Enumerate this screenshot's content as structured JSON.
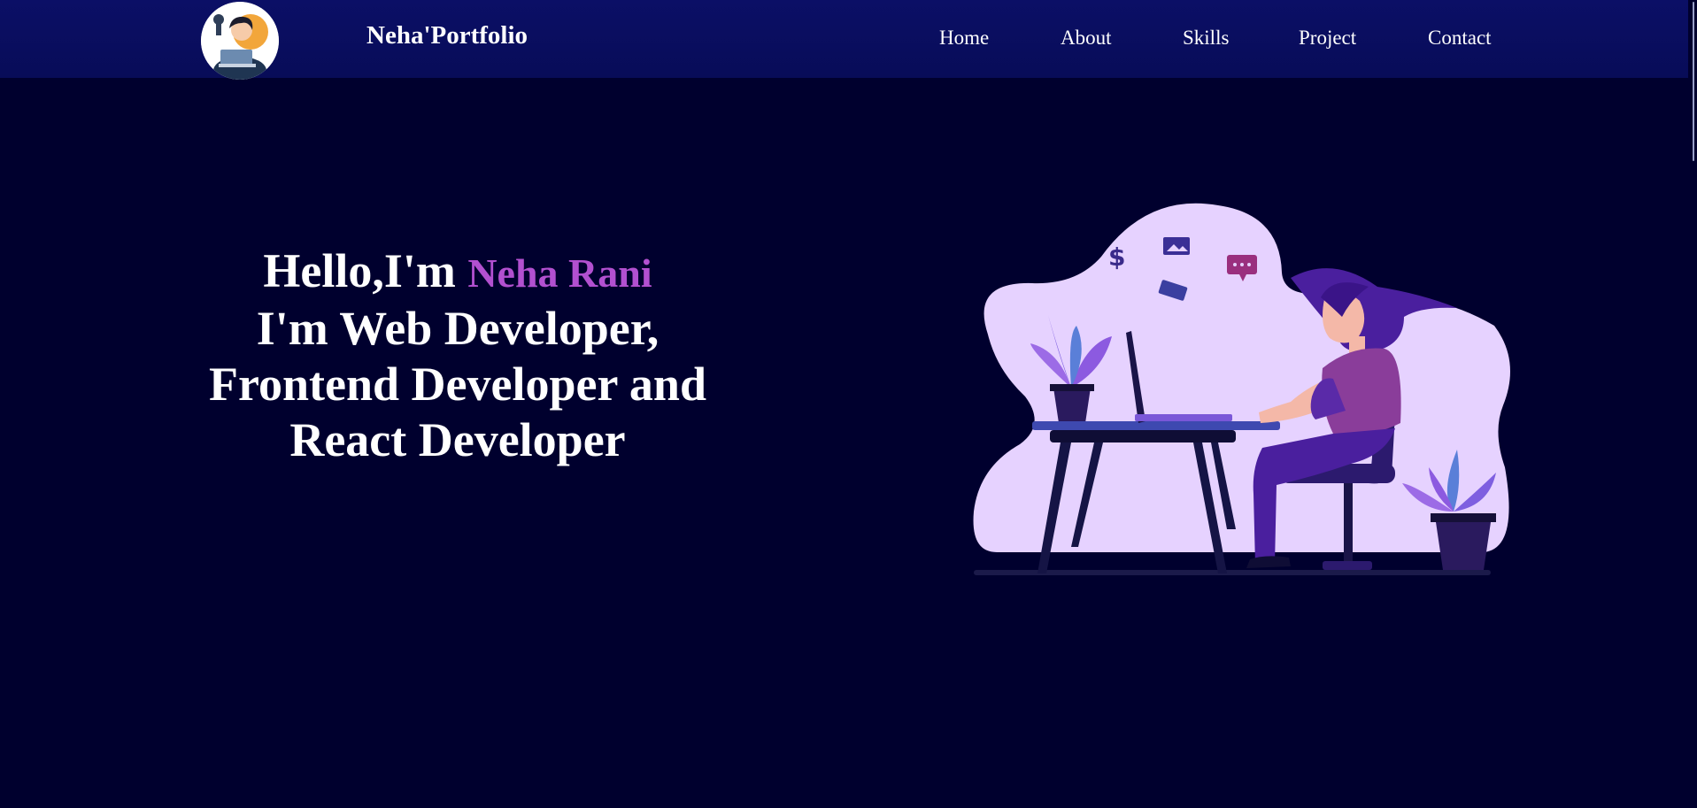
{
  "header": {
    "brand": "Neha'Portfolio",
    "nav": [
      "Home",
      "About",
      "Skills",
      "Project",
      "Contact"
    ]
  },
  "hero": {
    "greeting": "Hello,I'm",
    "name": "Neha Rani",
    "line2": "I'm Web Developer,",
    "line3": "Frontend Developer and",
    "line4": "React Developer"
  },
  "colors": {
    "background": "#00002e",
    "navbar": "#0b0f66",
    "name_accent": "#b250d0",
    "illustration_blob": "#e6d2ff",
    "illustration_purple": "#4b1f9a"
  },
  "icons": {
    "avatar": "woman-at-laptop-avatar",
    "illustration": "woman-working-at-desk-illustration"
  }
}
